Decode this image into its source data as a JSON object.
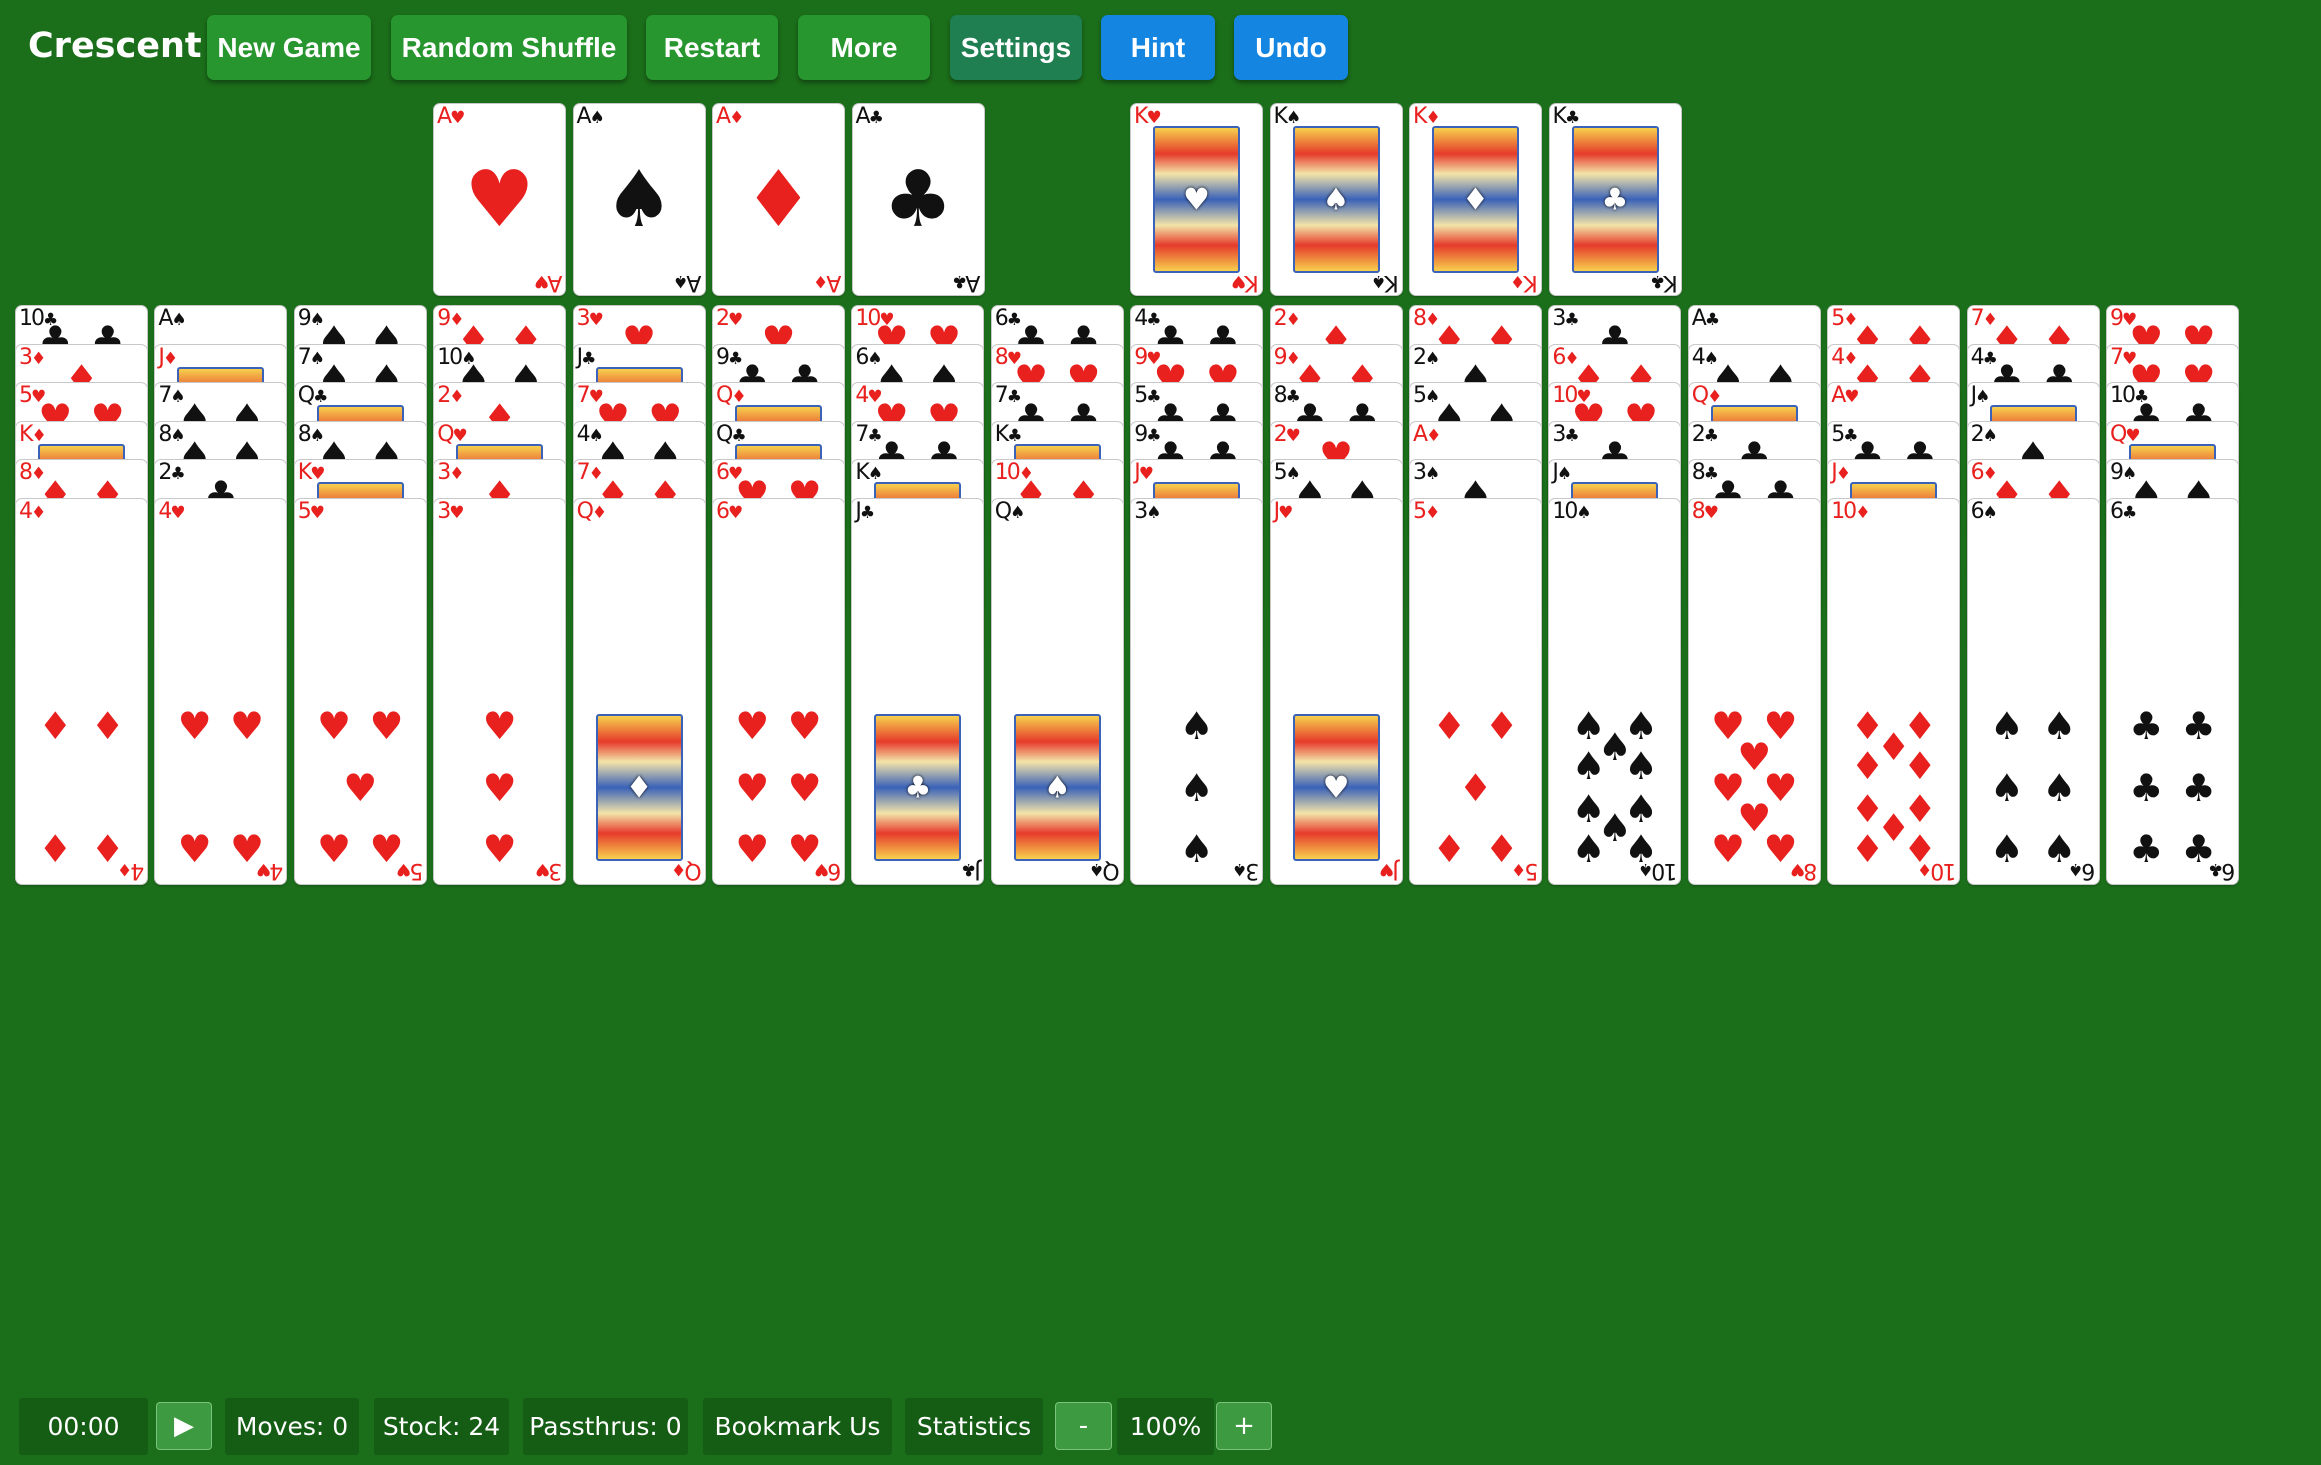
{
  "toolbar": {
    "title": "Crescent",
    "new_game": "New Game",
    "random_shuffle": "Random Shuffle",
    "restart": "Restart",
    "more": "More",
    "settings": "Settings",
    "hint": "Hint",
    "undo": "Undo"
  },
  "suits": {
    "H": "♥",
    "S": "♠",
    "D": "♦",
    "C": "♣"
  },
  "colors": {
    "felt": "#1b6e1a",
    "red": "#e8201e",
    "black": "#111111",
    "btn_green": "#27962f",
    "btn_blue": "#1485e0"
  },
  "foundations_aces": [
    {
      "rank": "A",
      "suit": "H"
    },
    {
      "rank": "A",
      "suit": "S"
    },
    {
      "rank": "A",
      "suit": "D"
    },
    {
      "rank": "A",
      "suit": "C"
    }
  ],
  "foundations_kings": [
    {
      "rank": "K",
      "suit": "H"
    },
    {
      "rank": "K",
      "suit": "S"
    },
    {
      "rank": "K",
      "suit": "D"
    },
    {
      "rank": "K",
      "suit": "C"
    }
  ],
  "tableau": [
    [
      {
        "rank": "10",
        "suit": "C"
      },
      {
        "rank": "3",
        "suit": "D"
      },
      {
        "rank": "5",
        "suit": "H"
      },
      {
        "rank": "K",
        "suit": "D"
      },
      {
        "rank": "8",
        "suit": "D"
      },
      {
        "rank": "4",
        "suit": "D"
      }
    ],
    [
      {
        "rank": "A",
        "suit": "S"
      },
      {
        "rank": "J",
        "suit": "D"
      },
      {
        "rank": "7",
        "suit": "S"
      },
      {
        "rank": "8",
        "suit": "S"
      },
      {
        "rank": "2",
        "suit": "C"
      },
      {
        "rank": "4",
        "suit": "H"
      }
    ],
    [
      {
        "rank": "9",
        "suit": "S"
      },
      {
        "rank": "7",
        "suit": "S"
      },
      {
        "rank": "Q",
        "suit": "C"
      },
      {
        "rank": "8",
        "suit": "S"
      },
      {
        "rank": "K",
        "suit": "H"
      },
      {
        "rank": "5",
        "suit": "H"
      }
    ],
    [
      {
        "rank": "9",
        "suit": "D"
      },
      {
        "rank": "10",
        "suit": "S"
      },
      {
        "rank": "2",
        "suit": "D"
      },
      {
        "rank": "Q",
        "suit": "H"
      },
      {
        "rank": "3",
        "suit": "D"
      },
      {
        "rank": "3",
        "suit": "H"
      }
    ],
    [
      {
        "rank": "3",
        "suit": "H"
      },
      {
        "rank": "J",
        "suit": "C"
      },
      {
        "rank": "7",
        "suit": "H"
      },
      {
        "rank": "4",
        "suit": "S"
      },
      {
        "rank": "7",
        "suit": "D"
      },
      {
        "rank": "Q",
        "suit": "D"
      }
    ],
    [
      {
        "rank": "2",
        "suit": "H"
      },
      {
        "rank": "9",
        "suit": "C"
      },
      {
        "rank": "Q",
        "suit": "D"
      },
      {
        "rank": "Q",
        "suit": "C"
      },
      {
        "rank": "6",
        "suit": "H"
      },
      {
        "rank": "6",
        "suit": "H"
      }
    ],
    [
      {
        "rank": "10",
        "suit": "H"
      },
      {
        "rank": "6",
        "suit": "S"
      },
      {
        "rank": "4",
        "suit": "H"
      },
      {
        "rank": "7",
        "suit": "C"
      },
      {
        "rank": "K",
        "suit": "S"
      },
      {
        "rank": "J",
        "suit": "C"
      }
    ],
    [
      {
        "rank": "6",
        "suit": "C"
      },
      {
        "rank": "8",
        "suit": "H"
      },
      {
        "rank": "7",
        "suit": "C"
      },
      {
        "rank": "K",
        "suit": "C"
      },
      {
        "rank": "10",
        "suit": "D"
      },
      {
        "rank": "Q",
        "suit": "S"
      }
    ],
    [
      {
        "rank": "4",
        "suit": "C"
      },
      {
        "rank": "9",
        "suit": "H"
      },
      {
        "rank": "5",
        "suit": "C"
      },
      {
        "rank": "9",
        "suit": "C"
      },
      {
        "rank": "J",
        "suit": "H"
      },
      {
        "rank": "3",
        "suit": "S"
      }
    ],
    [
      {
        "rank": "2",
        "suit": "D"
      },
      {
        "rank": "9",
        "suit": "D"
      },
      {
        "rank": "8",
        "suit": "C"
      },
      {
        "rank": "2",
        "suit": "H"
      },
      {
        "rank": "5",
        "suit": "S"
      },
      {
        "rank": "J",
        "suit": "H"
      }
    ],
    [
      {
        "rank": "8",
        "suit": "D"
      },
      {
        "rank": "2",
        "suit": "S"
      },
      {
        "rank": "5",
        "suit": "S"
      },
      {
        "rank": "A",
        "suit": "D"
      },
      {
        "rank": "3",
        "suit": "S"
      },
      {
        "rank": "5",
        "suit": "D"
      }
    ],
    [
      {
        "rank": "3",
        "suit": "C"
      },
      {
        "rank": "6",
        "suit": "D"
      },
      {
        "rank": "10",
        "suit": "H"
      },
      {
        "rank": "3",
        "suit": "C"
      },
      {
        "rank": "J",
        "suit": "S"
      },
      {
        "rank": "10",
        "suit": "S"
      }
    ],
    [
      {
        "rank": "A",
        "suit": "C"
      },
      {
        "rank": "4",
        "suit": "S"
      },
      {
        "rank": "Q",
        "suit": "D"
      },
      {
        "rank": "2",
        "suit": "C"
      },
      {
        "rank": "8",
        "suit": "C"
      },
      {
        "rank": "8",
        "suit": "H"
      }
    ],
    [
      {
        "rank": "5",
        "suit": "D"
      },
      {
        "rank": "4",
        "suit": "D"
      },
      {
        "rank": "A",
        "suit": "H"
      },
      {
        "rank": "5",
        "suit": "C"
      },
      {
        "rank": "J",
        "suit": "D"
      },
      {
        "rank": "10",
        "suit": "D"
      }
    ],
    [
      {
        "rank": "7",
        "suit": "D"
      },
      {
        "rank": "4",
        "suit": "C"
      },
      {
        "rank": "J",
        "suit": "S"
      },
      {
        "rank": "2",
        "suit": "S"
      },
      {
        "rank": "6",
        "suit": "D"
      },
      {
        "rank": "6",
        "suit": "S"
      }
    ],
    [
      {
        "rank": "9",
        "suit": "H"
      },
      {
        "rank": "7",
        "suit": "H"
      },
      {
        "rank": "10",
        "suit": "C"
      },
      {
        "rank": "Q",
        "suit": "H"
      },
      {
        "rank": "9",
        "suit": "S"
      },
      {
        "rank": "6",
        "suit": "C"
      }
    ]
  ],
  "status": {
    "timer": "00:00",
    "play_icon": "▶",
    "moves": "Moves: 0",
    "stock": "Stock: 24",
    "passthrus": "Passthrus: 0",
    "bookmark": "Bookmark Us",
    "statistics": "Statistics",
    "zoom_out": "-",
    "zoom": "100%",
    "zoom_in": "+"
  }
}
